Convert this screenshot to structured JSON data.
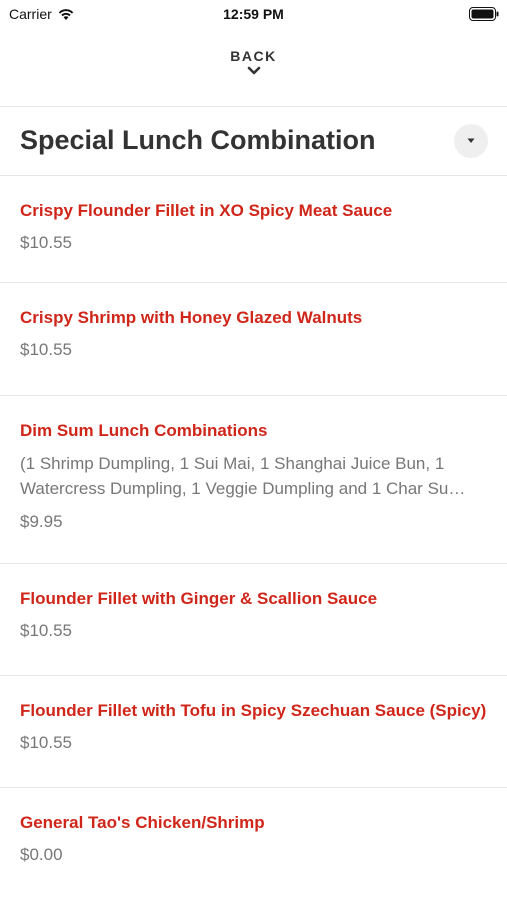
{
  "status_bar": {
    "carrier": "Carrier",
    "time": "12:59 PM"
  },
  "nav": {
    "back_label": "BACK"
  },
  "section": {
    "title": "Special Lunch Combination"
  },
  "items": [
    {
      "name": "Crispy Flounder Fillet in XO Spicy Meat Sauce",
      "description": "",
      "price": "$10.55"
    },
    {
      "name": "Crispy Shrimp with Honey Glazed Walnuts",
      "description": "",
      "price": "$10.55"
    },
    {
      "name": "Dim Sum Lunch Combinations",
      "description": "(1 Shrimp Dumpling, 1 Sui Mai, 1 Shanghai Juice Bun, 1 Watercress Dumpling, 1 Veggie Dumpling and 1 Char Su…",
      "price": "$9.95"
    },
    {
      "name": "Flounder Fillet with Ginger & Scallion Sauce",
      "description": "",
      "price": "$10.55"
    },
    {
      "name": "Flounder Fillet with Tofu in Spicy Szechuan Sauce (Spicy)",
      "description": "",
      "price": "$10.55"
    },
    {
      "name": "General Tao's Chicken/Shrimp",
      "description": "",
      "price": "$0.00"
    }
  ],
  "colors": {
    "item_name": "#d0261a",
    "price": "#777777"
  }
}
